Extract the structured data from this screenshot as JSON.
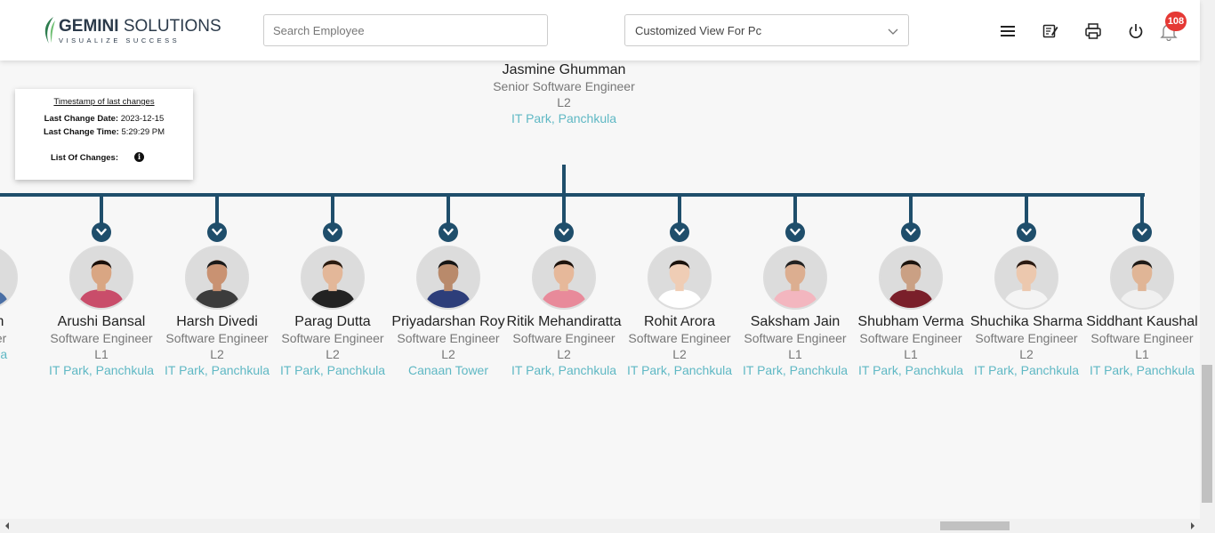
{
  "header": {
    "logo_brand": "GEMINI",
    "logo_word": " SOLUTIONS",
    "logo_tagline": "VISUALIZE SUCCESS",
    "search_placeholder": "Search Employee",
    "view_selected": "Customized View For Pc",
    "notification_count": "108",
    "icons": [
      "menu-icon",
      "edit-note-icon",
      "print-icon",
      "power-icon",
      "bell-icon"
    ]
  },
  "timestamp_card": {
    "title": "Timestamp of last changes",
    "date_label": "Last Change Date:",
    "date_value": "2023-12-15",
    "time_label": "Last Change Time:",
    "time_value": "5:29:29 PM",
    "changes_label": "List Of Changes:"
  },
  "manager": {
    "name": "Jasmine Ghumman",
    "role": "Senior Software Engineer L2",
    "location": "IT Park, Panchkula"
  },
  "employees": [
    {
      "name": "Singh",
      "role": "ngineer",
      "location": "nchkula"
    },
    {
      "name": "Arushi Bansal",
      "role": "Software Engineer L1",
      "location": "IT Park, Panchkula"
    },
    {
      "name": "Harsh Divedi",
      "role": "Software Engineer L2",
      "location": "IT Park, Panchkula"
    },
    {
      "name": "Parag Dutta",
      "role": "Software Engineer L2",
      "location": "IT Park, Panchkula"
    },
    {
      "name": "Priyadarshan Roy",
      "role": "Software Engineer L2",
      "location": "Canaan Tower"
    },
    {
      "name": "Ritik Mehandiratta",
      "role": "Software Engineer L2",
      "location": "IT Park, Panchkula"
    },
    {
      "name": "Rohit Arora",
      "role": "Software Engineer L2",
      "location": "IT Park, Panchkula"
    },
    {
      "name": "Saksham Jain",
      "role": "Software Engineer L1",
      "location": "IT Park, Panchkula"
    },
    {
      "name": "Shubham Verma",
      "role": "Software Engineer L1",
      "location": "IT Park, Panchkula"
    },
    {
      "name": "Shuchika Sharma",
      "role": "Software Engineer L2",
      "location": "IT Park, Panchkula"
    },
    {
      "name": "Siddhant Kaushal",
      "role": "Software Engineer L1",
      "location": "IT Park, Panchkula"
    }
  ],
  "colors": {
    "connector": "#1f4e6b",
    "location": "#5fb8c4",
    "badge": "#e53935"
  }
}
